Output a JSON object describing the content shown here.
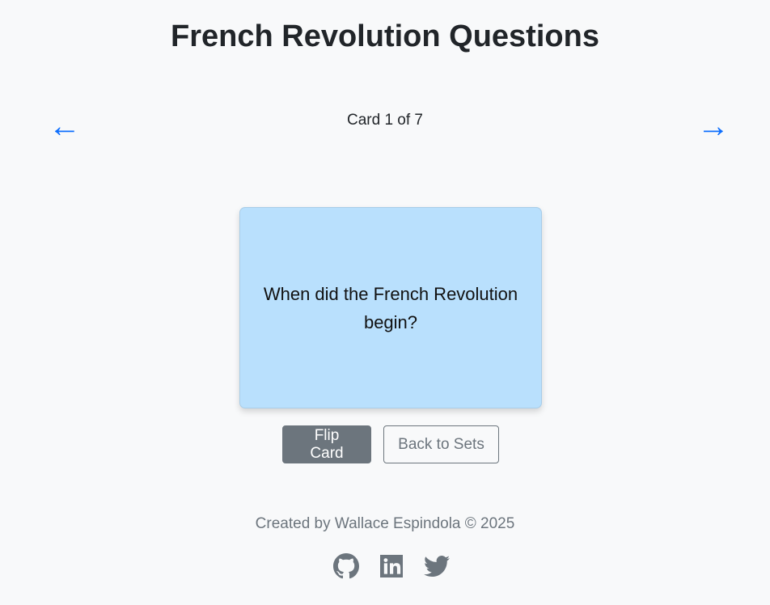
{
  "page": {
    "title": "French Revolution Questions"
  },
  "navigation": {
    "prev_label": "←",
    "next_label": "→",
    "counter": "Card 1 of 7"
  },
  "card": {
    "text": "When did the French Revolution begin?"
  },
  "actions": {
    "flip_label": "Flip Card",
    "back_label": "Back to Sets"
  },
  "footer": {
    "credit": "Created by Wallace Espindola © 2025",
    "social_icons": [
      "github-icon",
      "linkedin-icon",
      "twitter-icon"
    ]
  },
  "colors": {
    "background": "#f8f9fa",
    "accent": "#0d6efd",
    "card": "#b9e0fd",
    "secondary": "#6c757d"
  }
}
